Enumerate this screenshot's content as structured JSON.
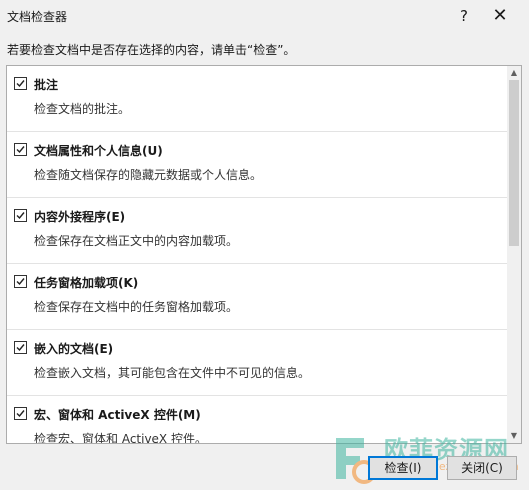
{
  "window": {
    "title": "文档检查器",
    "help_label": "?",
    "close_label": "✕"
  },
  "instruction": "若要检查文档中是否存在选择的内容，请单击“检查”。",
  "items": [
    {
      "label": "批注",
      "description": "检查文档的批注。",
      "checked": true
    },
    {
      "label": "文档属性和个人信息(U)",
      "description": "检查随文档保存的隐藏元数据或个人信息。",
      "checked": true
    },
    {
      "label": "内容外接程序(E)",
      "description": "检查保存在文档正文中的内容加载项。",
      "checked": true
    },
    {
      "label": "任务窗格加载项(K)",
      "description": "检查保存在文档中的任务窗格加载项。",
      "checked": true
    },
    {
      "label": "嵌入的文档(E)",
      "description": "检查嵌入文档，其可能包含在文件中不可见的信息。",
      "checked": true
    },
    {
      "label": "宏、窗体和 ActiveX 控件(M)",
      "description": "检查宏、窗体和 ActiveX 控件。",
      "checked": true
    }
  ],
  "buttons": {
    "inspect_label": "检查(I)",
    "close_label": "关闭(C)"
  },
  "watermark": {
    "text": "欧菲资源网",
    "sub": "www.officezhushou.com"
  },
  "colors": {
    "focus_border": "#0078d7",
    "watermark_green": "#3fb5a0",
    "watermark_orange": "#f28c28"
  }
}
